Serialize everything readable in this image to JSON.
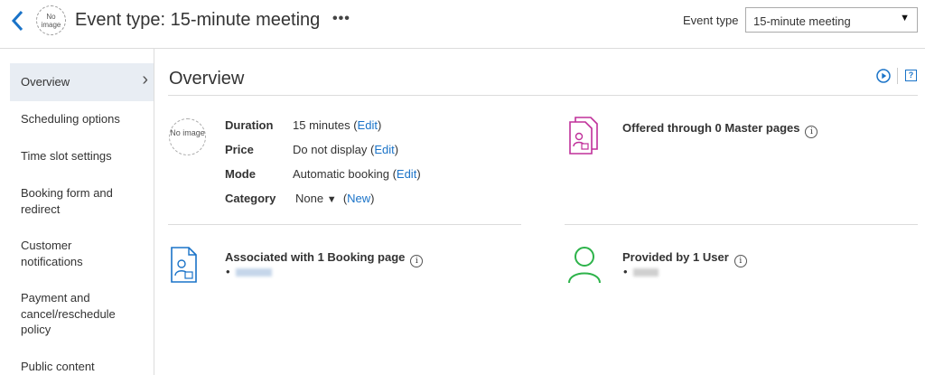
{
  "header": {
    "title": "Event type: 15-minute meeting",
    "more_label": "•••",
    "noimage_text": "No image",
    "event_type_label": "Event type",
    "event_type_selected": "15-minute meeting",
    "select_arrow": "▼"
  },
  "sidebar": {
    "items": [
      {
        "label": "Overview",
        "active": true
      },
      {
        "label": "Scheduling options"
      },
      {
        "label": "Time slot settings"
      },
      {
        "label": "Booking form and redirect"
      },
      {
        "label": "Customer notifications"
      },
      {
        "label": "Payment and cancel/reschedule policy"
      },
      {
        "label": "Public content"
      }
    ],
    "chevron": "›"
  },
  "main": {
    "title": "Overview",
    "help_label": "?",
    "noimage_text": "No image",
    "details": {
      "duration_label": "Duration",
      "duration_value": "15 minutes",
      "price_label": "Price",
      "price_value": "Do not display",
      "mode_label": "Mode",
      "mode_value": "Automatic booking",
      "category_label": "Category",
      "category_value": "None",
      "category_arrow": "▼",
      "edit_label": "Edit",
      "new_label": "New"
    },
    "master_pages": {
      "title": "Offered through 0 Master pages"
    },
    "booking_pages": {
      "title": "Associated with 1 Booking page"
    },
    "users": {
      "title": "Provided by 1 User"
    },
    "info_glyph": "i",
    "bullet": "•"
  },
  "colors": {
    "link": "#1a73c8",
    "accent_blue": "#1a73c8",
    "master_icon": "#c0309a",
    "user_icon": "#2db34a",
    "active_bg": "#e8edf3"
  },
  "icons": {
    "back": "chevron-left-icon",
    "play": "play-circle-icon",
    "help": "help-square-icon",
    "info": "info-circle-icon",
    "master": "master-page-icon",
    "booking": "booking-page-icon",
    "user": "user-icon"
  }
}
